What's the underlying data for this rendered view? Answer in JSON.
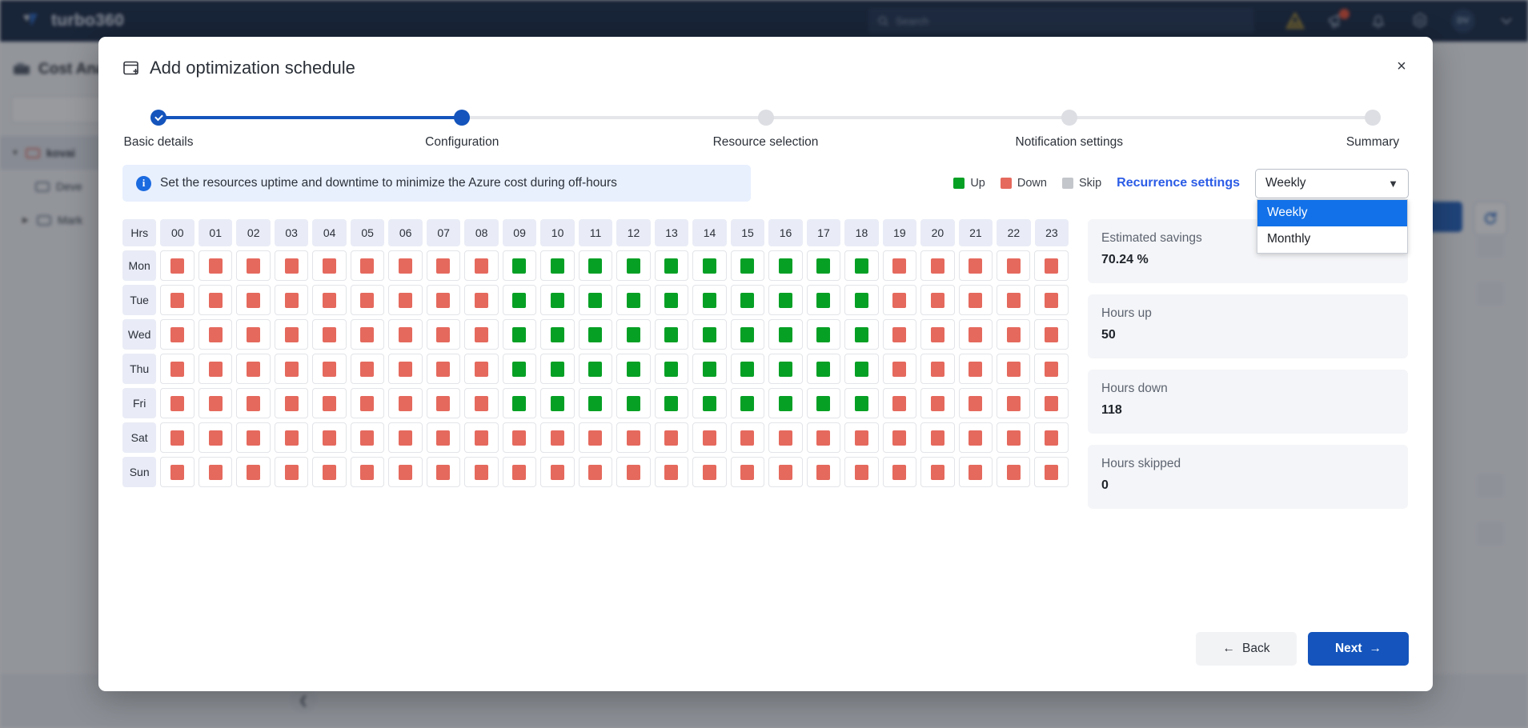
{
  "topbar": {
    "brand": "turbo360",
    "search_placeholder": "Search",
    "user_initials": "DV",
    "icons": [
      "warning-triangle-icon",
      "announcement-icon",
      "bell-icon",
      "gear-icon"
    ]
  },
  "background": {
    "page_title": "Cost Ana",
    "tree": [
      {
        "label": "kovai",
        "level": 1,
        "expanded": true
      },
      {
        "label": "Deve",
        "level": 2,
        "expanded": false
      },
      {
        "label": "Mark",
        "level": 2,
        "expanded": false
      }
    ]
  },
  "modal": {
    "title": "Add optimization schedule",
    "close_label": "×",
    "steps": [
      {
        "label": "Basic details",
        "state": "done"
      },
      {
        "label": "Configuration",
        "state": "active"
      },
      {
        "label": "Resource selection",
        "state": "todo"
      },
      {
        "label": "Notification settings",
        "state": "todo"
      },
      {
        "label": "Summary",
        "state": "todo"
      }
    ],
    "info_text": "Set the resources uptime and downtime to minimize the Azure cost during off-hours",
    "legend": [
      {
        "label": "Up",
        "color": "#06a025"
      },
      {
        "label": "Down",
        "color": "#e5695d"
      },
      {
        "label": "Skip",
        "color": "#c3c6cb"
      }
    ],
    "recurrence_link": "Recurrence settings",
    "recurrence_select": {
      "value": "Weekly",
      "open": true,
      "options": [
        "Weekly",
        "Monthly"
      ],
      "selected_index": 0
    },
    "footer": {
      "back_label": "Back",
      "next_label": "Next"
    }
  },
  "schedule": {
    "hours_header": "Hrs",
    "hours": [
      "00",
      "01",
      "02",
      "03",
      "04",
      "05",
      "06",
      "07",
      "08",
      "09",
      "10",
      "11",
      "12",
      "13",
      "14",
      "15",
      "16",
      "17",
      "18",
      "19",
      "20",
      "21",
      "22",
      "23"
    ],
    "days": [
      "Mon",
      "Tue",
      "Wed",
      "Thu",
      "Fri",
      "Sat",
      "Sun"
    ],
    "matrix": [
      [
        "down",
        "down",
        "down",
        "down",
        "down",
        "down",
        "down",
        "down",
        "down",
        "up",
        "up",
        "up",
        "up",
        "up",
        "up",
        "up",
        "up",
        "up",
        "up",
        "down",
        "down",
        "down",
        "down",
        "down"
      ],
      [
        "down",
        "down",
        "down",
        "down",
        "down",
        "down",
        "down",
        "down",
        "down",
        "up",
        "up",
        "up",
        "up",
        "up",
        "up",
        "up",
        "up",
        "up",
        "up",
        "down",
        "down",
        "down",
        "down",
        "down"
      ],
      [
        "down",
        "down",
        "down",
        "down",
        "down",
        "down",
        "down",
        "down",
        "down",
        "up",
        "up",
        "up",
        "up",
        "up",
        "up",
        "up",
        "up",
        "up",
        "up",
        "down",
        "down",
        "down",
        "down",
        "down"
      ],
      [
        "down",
        "down",
        "down",
        "down",
        "down",
        "down",
        "down",
        "down",
        "down",
        "up",
        "up",
        "up",
        "up",
        "up",
        "up",
        "up",
        "up",
        "up",
        "up",
        "down",
        "down",
        "down",
        "down",
        "down"
      ],
      [
        "down",
        "down",
        "down",
        "down",
        "down",
        "down",
        "down",
        "down",
        "down",
        "up",
        "up",
        "up",
        "up",
        "up",
        "up",
        "up",
        "up",
        "up",
        "up",
        "down",
        "down",
        "down",
        "down",
        "down"
      ],
      [
        "down",
        "down",
        "down",
        "down",
        "down",
        "down",
        "down",
        "down",
        "down",
        "down",
        "down",
        "down",
        "down",
        "down",
        "down",
        "down",
        "down",
        "down",
        "down",
        "down",
        "down",
        "down",
        "down",
        "down"
      ],
      [
        "down",
        "down",
        "down",
        "down",
        "down",
        "down",
        "down",
        "down",
        "down",
        "down",
        "down",
        "down",
        "down",
        "down",
        "down",
        "down",
        "down",
        "down",
        "down",
        "down",
        "down",
        "down",
        "down",
        "down"
      ]
    ]
  },
  "stats": [
    {
      "label": "Estimated savings",
      "value": "70.24 %"
    },
    {
      "label": "Hours up",
      "value": "50"
    },
    {
      "label": "Hours down",
      "value": "118"
    },
    {
      "label": "Hours skipped",
      "value": "0"
    }
  ]
}
